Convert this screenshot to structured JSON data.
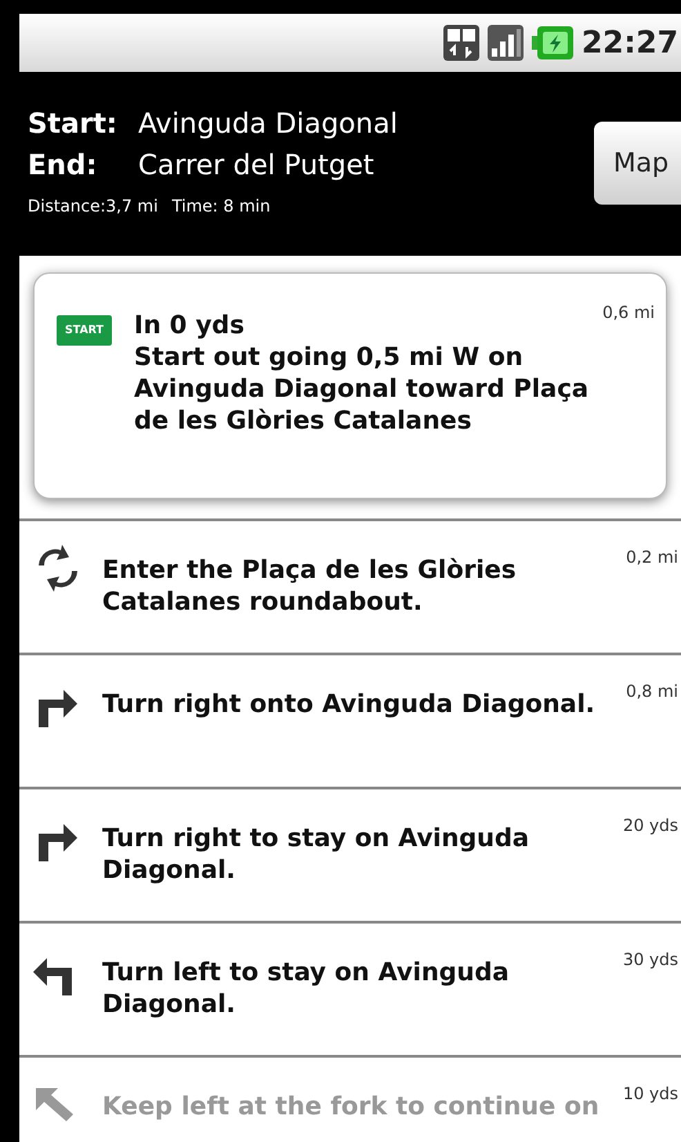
{
  "status_bar": {
    "time": "22:27"
  },
  "header": {
    "start_label": "Start:",
    "start": "Avinguda Diagonal",
    "end_label": "End:",
    "end": "Carrer del Putget",
    "distance": "Distance:3,7 mi",
    "time": "Time: 8 min",
    "map_button": "Map"
  },
  "steps": [
    {
      "kind": "start",
      "badge": "START",
      "lead": "In 0 yds",
      "text": "Start out going 0,5 mi W on Avinguda Diagonal toward Plaça de les Glòries Catalanes",
      "distance": "0,6 mi",
      "selected": true
    },
    {
      "kind": "roundabout",
      "text": "Enter the Plaça de les Glòries Catalanes roundabout.",
      "distance": "0,2 mi",
      "selected": false
    },
    {
      "kind": "right",
      "text": "Turn right onto Avinguda Diagonal.",
      "distance": "0,8 mi",
      "selected": false
    },
    {
      "kind": "right",
      "text": "Turn right to stay on Avinguda Diagonal.",
      "distance": "20 yds",
      "selected": false
    },
    {
      "kind": "left",
      "text": "Turn left to stay on Avinguda Diagonal.",
      "distance": "30 yds",
      "selected": false
    },
    {
      "kind": "keep_left",
      "text": "Keep left at the fork to continue on",
      "distance": "10 yds",
      "selected": false
    }
  ]
}
